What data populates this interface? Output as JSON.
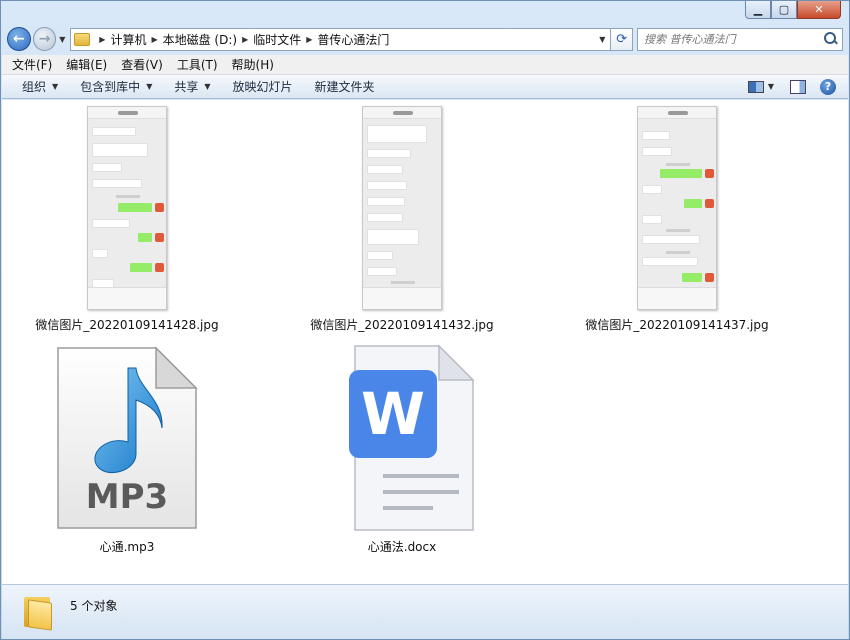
{
  "window": {
    "caption": {
      "minimize": "▁",
      "maximize": "▢",
      "close": "✕"
    }
  },
  "address": {
    "crumbs": [
      "计算机",
      "本地磁盘 (D:)",
      "临时文件",
      "普传心通法门"
    ]
  },
  "search": {
    "placeholder": "搜索 普传心通法门"
  },
  "menu": [
    "文件(F)",
    "编辑(E)",
    "查看(V)",
    "工具(T)",
    "帮助(H)"
  ],
  "toolbar": {
    "organize": "组织",
    "include_library": "包含到库中",
    "share": "共享",
    "slideshow": "放映幻灯片",
    "new_folder": "新建文件夹"
  },
  "files": [
    {
      "name": "微信图片_20220109141428.jpg",
      "type": "image",
      "icon": "wechat-screenshot-thumbnail"
    },
    {
      "name": "微信图片_20220109141432.jpg",
      "type": "image",
      "icon": "wechat-screenshot-thumbnail"
    },
    {
      "name": "微信图片_20220109141437.jpg",
      "type": "image",
      "icon": "wechat-screenshot-thumbnail"
    },
    {
      "name": "心通.mp3",
      "type": "audio",
      "icon": "mp3-file-icon",
      "badge": "MP3"
    },
    {
      "name": "心通法.docx",
      "type": "document",
      "icon": "wps-doc-icon",
      "badge": "W"
    }
  ],
  "status": {
    "text": "5 个对象"
  },
  "colors": {
    "accent": "#2d6cc0",
    "wps_blue": "#4a86e8",
    "wechat_green": "#95ec69",
    "folder_yellow": "#f2c44a"
  }
}
